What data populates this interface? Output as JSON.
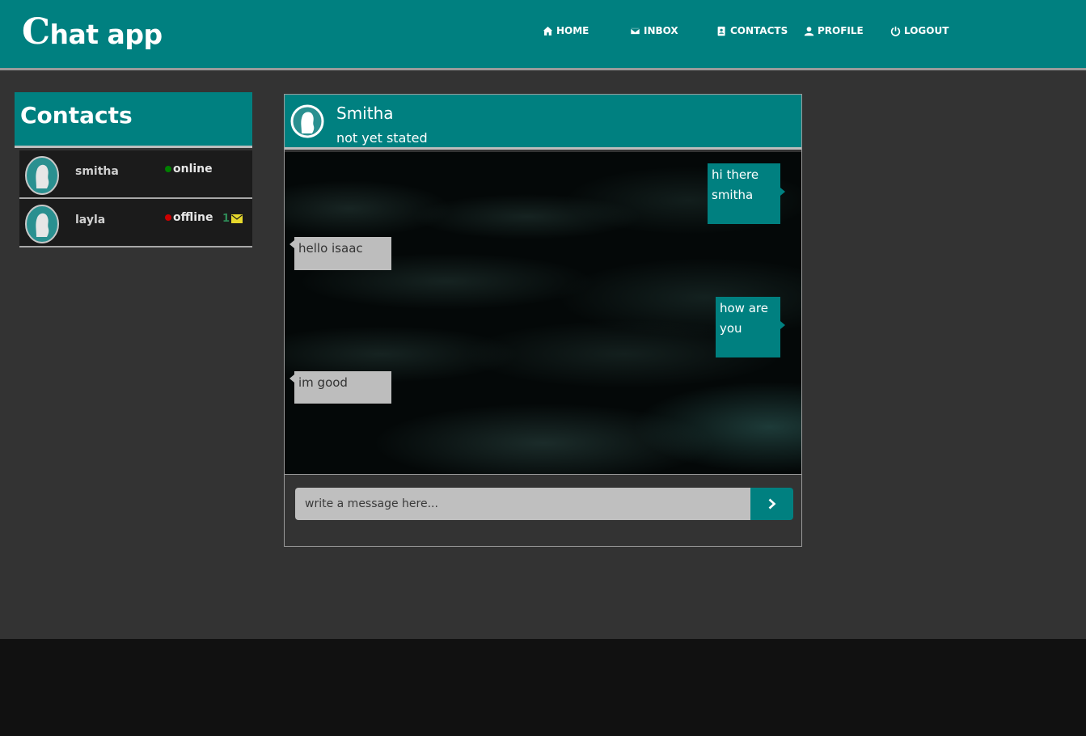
{
  "app": {
    "title_cap": "C",
    "title_rest": "hat app"
  },
  "nav": [
    {
      "label": "HOME",
      "icon": "home-icon"
    },
    {
      "label": "INBOX",
      "icon": "envelope-icon"
    },
    {
      "label": "CONTACTS",
      "icon": "address-book-icon"
    },
    {
      "label": "PROFILE",
      "icon": "user-icon"
    },
    {
      "label": "LOGOUT",
      "icon": "power-icon"
    }
  ],
  "contacts": {
    "title": "Contacts",
    "items": [
      {
        "name": "smitha",
        "status": "online",
        "status_color": "#008000",
        "unread": ""
      },
      {
        "name": "layla",
        "status": "offline",
        "status_color": "#cc0000",
        "unread": "1"
      }
    ]
  },
  "chat": {
    "name": "Smitha",
    "status": "not yet stated",
    "messages": [
      {
        "from": "me",
        "text_lines": [
          "hi there",
          "smitha"
        ]
      },
      {
        "from": "them",
        "text": "hello isaac"
      },
      {
        "from": "me",
        "text_lines": [
          "how are",
          "you"
        ]
      },
      {
        "from": "them",
        "text": "im good"
      }
    ],
    "input_placeholder": "write a message here..."
  },
  "colors": {
    "accent": "#008080",
    "background": "#333333",
    "footer": "#111111",
    "unread_icon": "#e6d82c"
  }
}
